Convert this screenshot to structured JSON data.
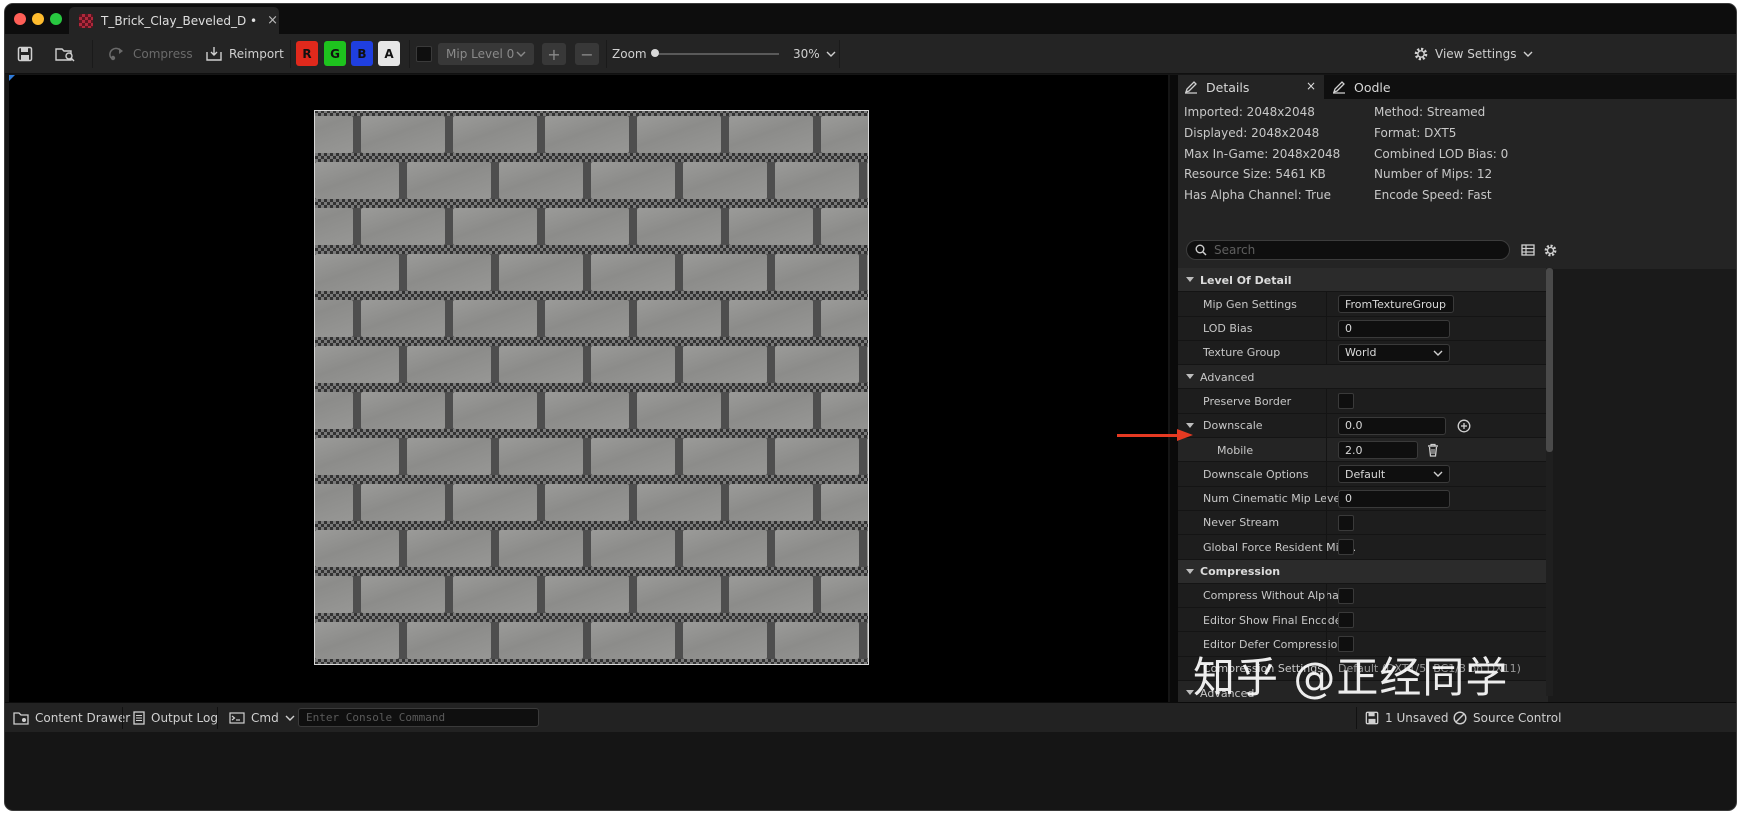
{
  "window": {
    "tab_title": "T_Brick_Clay_Beveled_D •",
    "tab_close": "×"
  },
  "toolbar": {
    "compress_label": "Compress",
    "reimport_label": "Reimport",
    "channels": [
      {
        "label": "R",
        "color": "#e0291c"
      },
      {
        "label": "G",
        "color": "#1ec31e"
      },
      {
        "label": "B",
        "color": "#1f3fe0"
      },
      {
        "label": "A",
        "color": "#e6e6e6"
      }
    ],
    "mip_level_label": "Mip Level 0",
    "zoom_label": "Zoom",
    "zoom_value": "30%",
    "view_settings_label": "View Settings"
  },
  "details": {
    "tabs": [
      {
        "label": "Details",
        "close": "×"
      },
      {
        "label": "Oodle"
      }
    ],
    "info_left": [
      "Imported: 2048x2048",
      "Displayed: 2048x2048",
      "Max In-Game: 2048x2048",
      "Resource Size: 5461 KB",
      "Has Alpha Channel: True"
    ],
    "info_right": [
      "Method: Streamed",
      "Format: DXT5",
      "Combined LOD Bias: 0",
      "Number of Mips: 12",
      "Encode Speed: Fast"
    ],
    "search_placeholder": "Search",
    "properties": [
      {
        "kind": "cat",
        "name": "Level Of Detail"
      },
      {
        "kind": "combo",
        "name": "Mip Gen Settings",
        "value": "FromTextureGroup"
      },
      {
        "kind": "input",
        "name": "LOD Bias",
        "value": "0"
      },
      {
        "kind": "combo",
        "name": "Texture Group",
        "value": "World"
      },
      {
        "kind": "sub",
        "name": "Advanced"
      },
      {
        "kind": "check",
        "name": "Preserve Border"
      },
      {
        "kind": "input-plus",
        "name": "Downscale",
        "value": "0.0"
      },
      {
        "kind": "input-trash",
        "name": "Mobile",
        "value": "2.0"
      },
      {
        "kind": "combo",
        "name": "Downscale Options",
        "value": "Default"
      },
      {
        "kind": "input",
        "name": "Num Cinematic Mip Levels",
        "value": "0"
      },
      {
        "kind": "check",
        "name": "Never Stream"
      },
      {
        "kind": "check",
        "name": "Global Force Resident Mip..."
      },
      {
        "kind": "cat",
        "name": "Compression"
      },
      {
        "kind": "check",
        "name": "Compress Without Alpha"
      },
      {
        "kind": "check",
        "name": "Editor Show Final Encode"
      },
      {
        "kind": "check",
        "name": "Editor Defer Compression"
      },
      {
        "kind": "text",
        "name": "Compression Settings",
        "value": "Default (DXT1/5, BC1/3 on DX11)"
      },
      {
        "kind": "sub",
        "name": "Advanced"
      }
    ]
  },
  "watermark": "知乎 @正经同学",
  "statusbar": {
    "content_drawer_label": "Content Drawer",
    "output_log_label": "Output Log",
    "cmd_label": "Cmd",
    "console_placeholder": "Enter Console Command",
    "unsaved_label": "1 Unsaved",
    "source_control_label": "Source Control"
  }
}
